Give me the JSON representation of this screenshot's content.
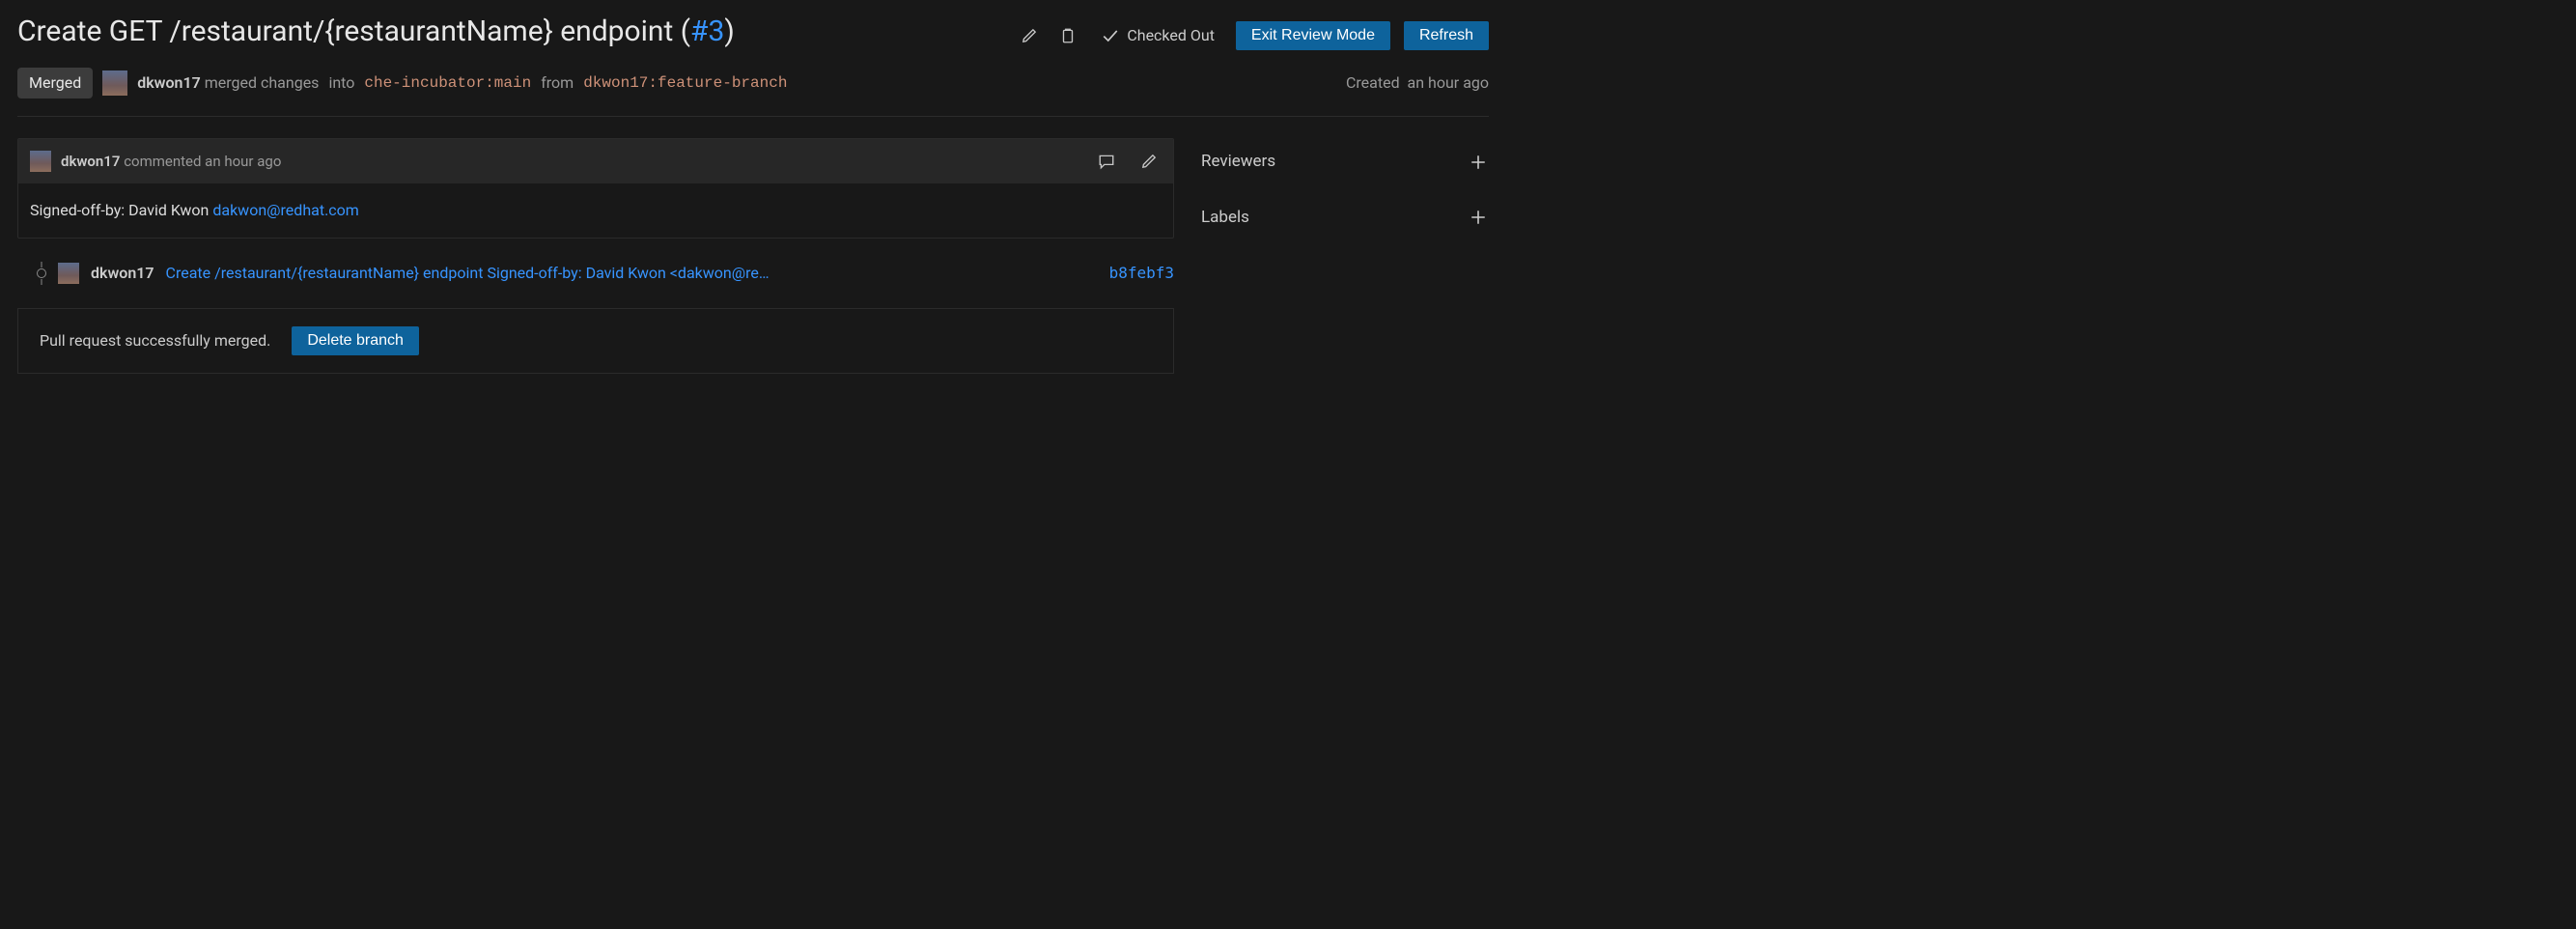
{
  "header": {
    "title": "Create GET /restaurant/{restaurantName} endpoint",
    "pr_number": "#3",
    "checked_out": "Checked Out",
    "exit_review": "Exit Review Mode",
    "refresh": "Refresh"
  },
  "subheader": {
    "status": "Merged",
    "user": "dkwon17",
    "merged_changes": "merged changes",
    "into": "into",
    "target": "che-incubator:main",
    "from": "from",
    "source": "dkwon17:feature-branch",
    "created_label": "Created",
    "created_time": "an hour ago"
  },
  "comment": {
    "author": "dkwon17",
    "action": "commented an hour ago",
    "body_prefix": "Signed-off-by: David Kwon ",
    "email": "dakwon@redhat.com"
  },
  "commit": {
    "author": "dkwon17",
    "message": "Create /restaurant/{restaurantName} endpoint Signed-off-by: David Kwon <dakwon@re…",
    "sha": "b8febf3"
  },
  "merged": {
    "message": "Pull request successfully merged.",
    "delete_branch": "Delete branch"
  },
  "sidebar": {
    "reviewers": "Reviewers",
    "labels": "Labels"
  }
}
